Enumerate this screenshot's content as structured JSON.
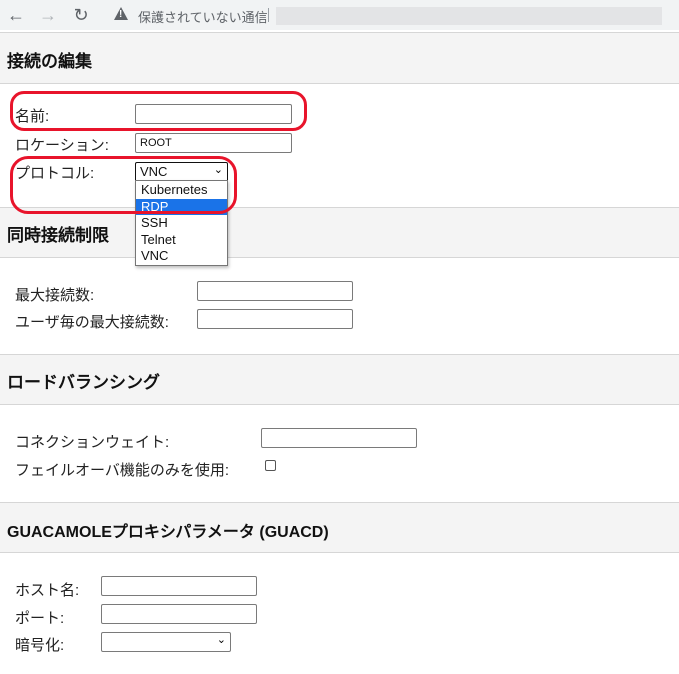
{
  "browser": {
    "security_warning": "保護されていない通信",
    "icons": {
      "back": "back-arrow-icon",
      "forward": "forward-arrow-icon",
      "reload": "reload-icon",
      "warning": "warning-icon"
    }
  },
  "sections": {
    "edit_connection": {
      "title": "接続の編集",
      "name_label": "名前:",
      "name_value": "",
      "location_label": "ロケーション:",
      "location_value": "ROOT",
      "protocol_label": "プロトコル:",
      "protocol_selected": "VNC",
      "protocol_options": [
        "Kubernetes",
        "RDP",
        "SSH",
        "Telnet",
        "VNC"
      ],
      "protocol_highlighted": "RDP"
    },
    "concurrency": {
      "title": "同時接続制限",
      "max_connections_label": "最大接続数:",
      "max_connections_value": "",
      "max_per_user_label": "ユーザ毎の最大接続数:",
      "max_per_user_value": ""
    },
    "load_balancing": {
      "title": "ロードバランシング",
      "weight_label": "コネクションウェイト:",
      "weight_value": "",
      "failover_label": "フェイルオーバ機能のみを使用:",
      "failover_checked": false
    },
    "guacd": {
      "title": "GUACAMOLEプロキシパラメータ (GUACD)",
      "hostname_label": "ホスト名:",
      "hostname_value": "",
      "port_label": "ポート:",
      "port_value": "",
      "encryption_label": "暗号化:",
      "encryption_selected": ""
    }
  },
  "annotation_color": "#e8142b"
}
